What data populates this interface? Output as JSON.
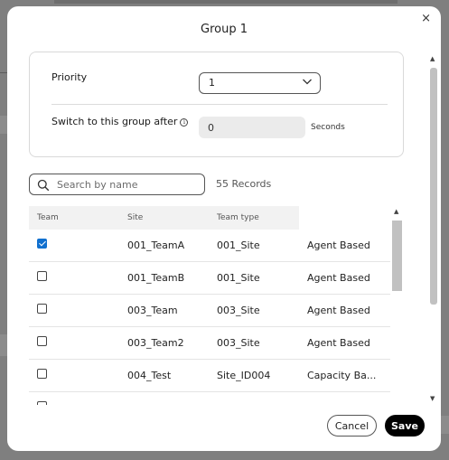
{
  "dialog": {
    "title": "Group 1",
    "close_label": "×"
  },
  "settings": {
    "priority_label": "Priority",
    "priority_value": "1",
    "switch_label": "Switch to this group after",
    "switch_value": "0",
    "seconds_label": "Seconds"
  },
  "search": {
    "placeholder": "Search by name",
    "records": "55 Records"
  },
  "table": {
    "columns": {
      "team": "Team",
      "site": "Site",
      "team_type": "Team type"
    },
    "rows": [
      {
        "checked": true,
        "team": "001_TeamA",
        "site": "001_Site",
        "type": "Agent Based"
      },
      {
        "checked": false,
        "team": "001_TeamB",
        "site": "001_Site",
        "type": "Agent Based"
      },
      {
        "checked": false,
        "team": "003_Team",
        "site": "003_Site",
        "type": "Agent Based"
      },
      {
        "checked": false,
        "team": "003_Team2",
        "site": "003_Site",
        "type": "Agent Based"
      },
      {
        "checked": false,
        "team": "004_Test",
        "site": "Site_ID004",
        "type": "Capacity Ba..."
      }
    ]
  },
  "footer": {
    "cancel_label": "Cancel",
    "save_label": "Save"
  },
  "colors": {
    "accent": "#1170cf",
    "save_bg": "#000000",
    "overlay": "#7f7f7f"
  }
}
